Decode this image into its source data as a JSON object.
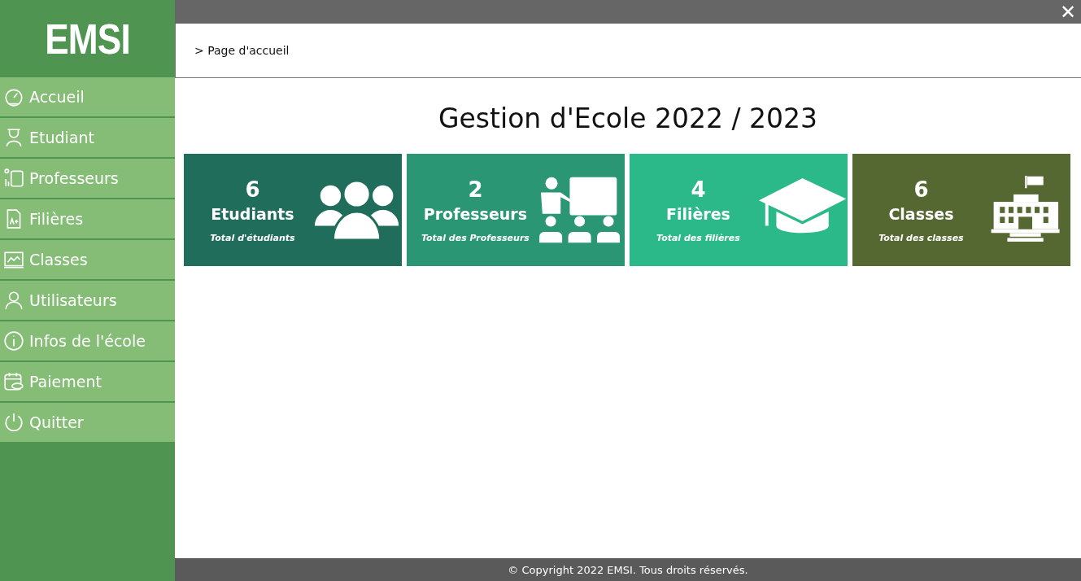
{
  "sidebar": {
    "logo": "EMSI",
    "items": [
      {
        "label": "Accueil"
      },
      {
        "label": "Etudiant"
      },
      {
        "label": "Professeurs"
      },
      {
        "label": "Filières"
      },
      {
        "label": "Classes"
      },
      {
        "label": "Utilisateurs"
      },
      {
        "label": "Infos de l'école"
      },
      {
        "label": "Paiement"
      },
      {
        "label": "Quitter"
      }
    ]
  },
  "close": "✕",
  "breadcrumb": "> Page d'accueil",
  "title": "Gestion d'Ecole 2022 / 2023",
  "cards": [
    {
      "count": "6",
      "label": "Etudiants",
      "caption": "Total d'étudiants",
      "color": "#216d5c"
    },
    {
      "count": "2",
      "label": "Professeurs",
      "caption": "Total des Professeurs",
      "color": "#2a9673"
    },
    {
      "count": "4",
      "label": "Filières",
      "caption": "Total des filières",
      "color": "#2bb98a"
    },
    {
      "count": "6",
      "label": "Classes",
      "caption": "Total des classes",
      "color": "#566831"
    }
  ],
  "footer": "© Copyright 2022 EMSI. Tous droits réservés."
}
